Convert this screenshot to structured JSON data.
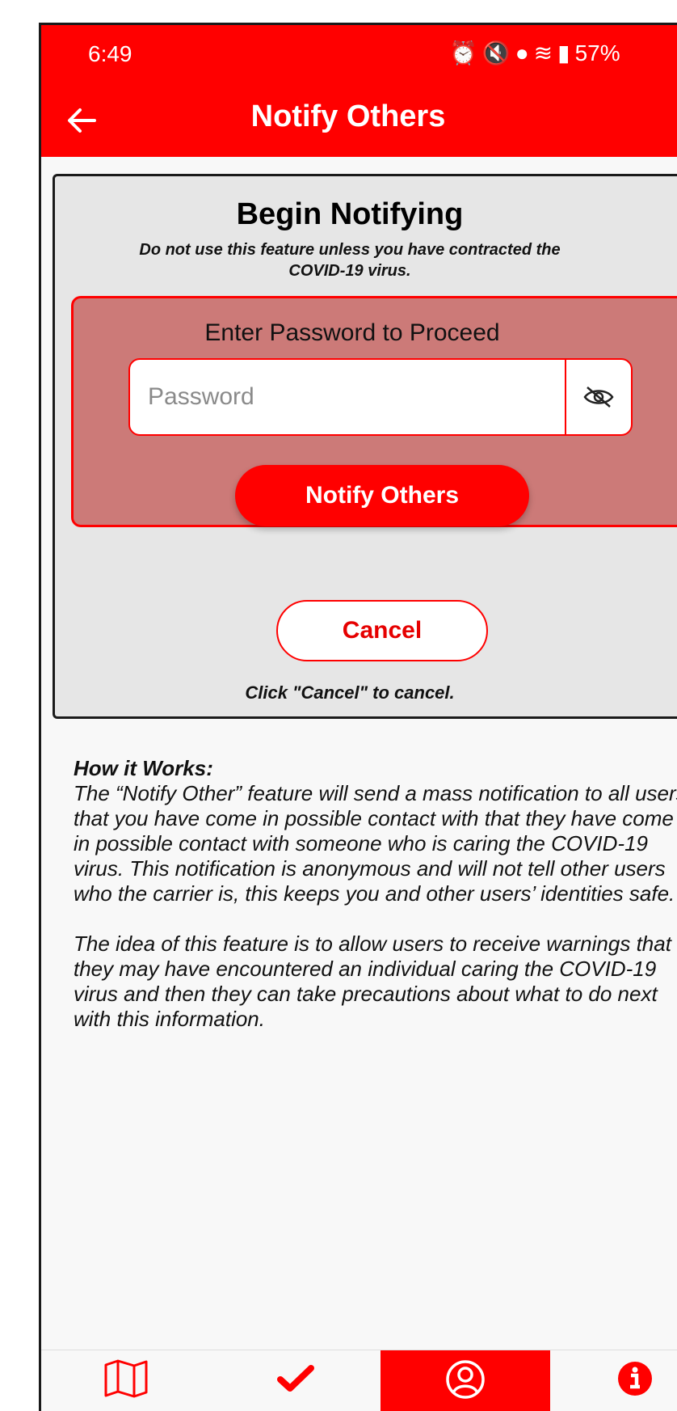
{
  "status_bar": {
    "time": "6:49",
    "battery": "57%"
  },
  "header": {
    "title": "Notify Others"
  },
  "card": {
    "title": "Begin Notifying",
    "subtitle": "Do not use this feature unless you have contracted the COVID-19 virus.",
    "password_section": {
      "label": "Enter Password to Proceed",
      "placeholder": "Password",
      "button_label": "Notify Others"
    },
    "cancel_label": "Cancel",
    "cancel_hint": "Click \"Cancel\" to cancel."
  },
  "how_it_works": {
    "title": "How it Works:",
    "paragraph_1": "The “Notify Other” feature will send a mass notification to all users that you have come in possible contact with that they have come in possible contact with someone who is caring the COVID-19 virus. This notification is anonymous and will not tell other users who the carrier is, this keeps you and other users’ identities safe.",
    "paragraph_2": "The idea of this feature is to allow users to receive warnings that they may have encountered an individual caring the COVID-19 virus and then they can take precautions about what to do next with this information."
  },
  "bottom_nav": {
    "items": [
      {
        "icon": "map-icon",
        "active": false
      },
      {
        "icon": "checkmark-icon",
        "active": false
      },
      {
        "icon": "user-icon",
        "active": true
      },
      {
        "icon": "info-icon",
        "active": false
      }
    ]
  },
  "colors": {
    "primary": "#ff0000",
    "panel": "#cc7a78",
    "card": "#e6e6e6"
  }
}
